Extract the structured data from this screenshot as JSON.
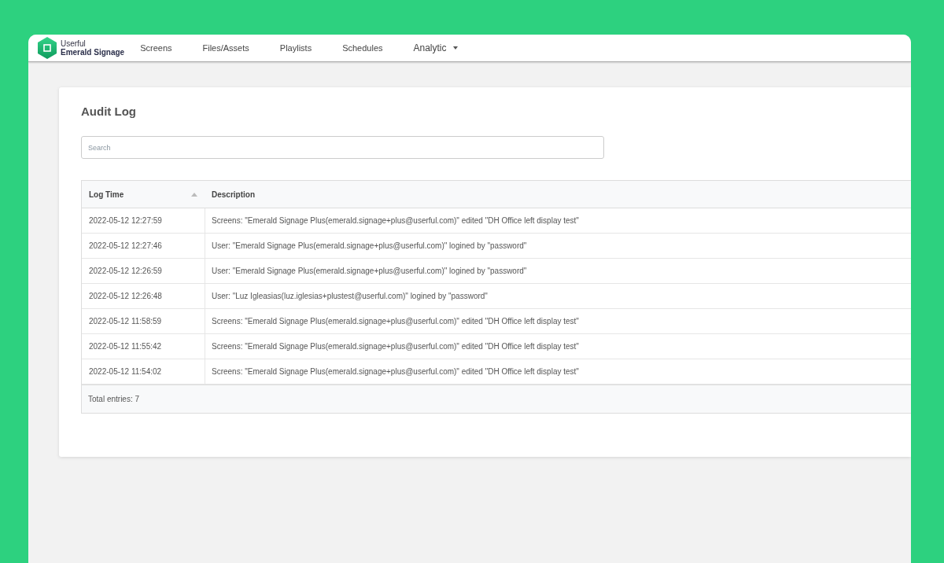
{
  "brand": {
    "line1": "Userful",
    "line2": "Emerald Signage"
  },
  "nav": [
    {
      "label": "Screens",
      "dropdown": false
    },
    {
      "label": "Files/Assets",
      "dropdown": false
    },
    {
      "label": "Playlists",
      "dropdown": false
    },
    {
      "label": "Schedules",
      "dropdown": false
    },
    {
      "label": "Analytic",
      "dropdown": true
    }
  ],
  "page_title": "Audit Log",
  "search": {
    "placeholder": "Search"
  },
  "table": {
    "columns": [
      {
        "label": "Log Time",
        "sortable": true
      },
      {
        "label": "Description",
        "sortable": false
      }
    ],
    "rows": [
      [
        "2022-05-12 12:27:59",
        "Screens: \"Emerald Signage Plus(emerald.signage+plus@userful.com)\" edited \"DH Office left display test\""
      ],
      [
        "2022-05-12 12:27:46",
        "User: \"Emerald Signage Plus(emerald.signage+plus@userful.com)\" logined by \"password\""
      ],
      [
        "2022-05-12 12:26:59",
        "User: \"Emerald Signage Plus(emerald.signage+plus@userful.com)\" logined by \"password\""
      ],
      [
        "2022-05-12 12:26:48",
        "User: \"Luz Igleasias(luz.iglesias+plustest@userful.com)\" logined by \"password\""
      ],
      [
        "2022-05-12 11:58:59",
        "Screens: \"Emerald Signage Plus(emerald.signage+plus@userful.com)\" edited \"DH Office left display test\""
      ],
      [
        "2022-05-12 11:55:42",
        "Screens: \"Emerald Signage Plus(emerald.signage+plus@userful.com)\" edited \"DH Office left display test\""
      ],
      [
        "2022-05-12 11:54:02",
        "Screens: \"Emerald Signage Plus(emerald.signage+plus@userful.com)\" edited \"DH Office left display test\""
      ]
    ],
    "footer": "Total entries: 7"
  }
}
